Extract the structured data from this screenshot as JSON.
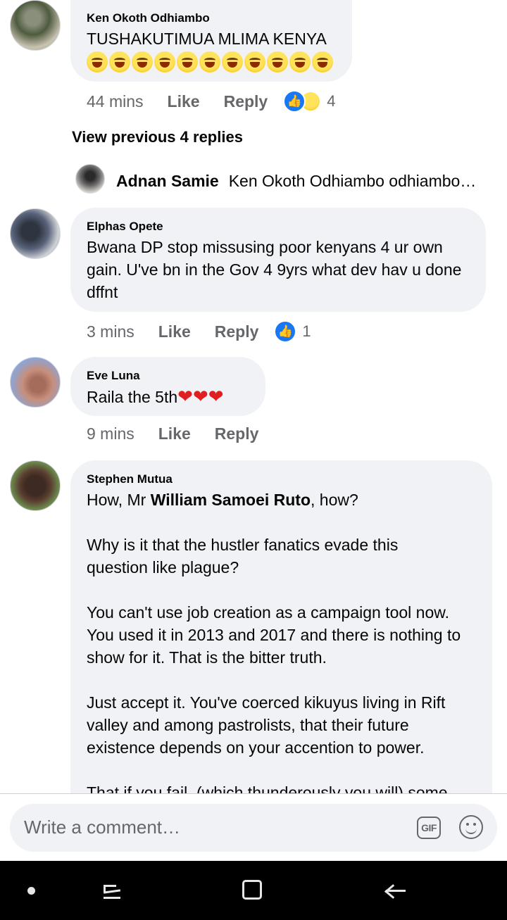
{
  "comments": [
    {
      "author": "Ken Okoth Odhiambo",
      "text": "TUSHAKUTIMUA MLIMA KENYA",
      "emoji_icon": "rolling-on-floor-laughing",
      "emoji_count": 11,
      "time": "44 mins",
      "like_label": "Like",
      "reply_label": "Reply",
      "reaction_icons": [
        "like",
        "haha"
      ],
      "reaction_count": "4"
    },
    {
      "author": "Elphas Opete",
      "text": "Bwana DP stop missusing poor kenyans 4 ur own\ngain. U've bn in the Gov 4 9yrs what dev hav u done\ndffnt",
      "time": "3 mins",
      "like_label": "Like",
      "reply_label": "Reply",
      "reaction_icons": [
        "like"
      ],
      "reaction_count": "1"
    },
    {
      "author": "Eve Luna",
      "text": "Raila the 5th",
      "emoji_icon": "red-heart",
      "emoji_count": 3,
      "time": "9 mins",
      "like_label": "Like",
      "reply_label": "Reply"
    },
    {
      "author": "Stephen Mutua",
      "text_prefix": "How, Mr ",
      "text_bold": "William Samoei Ruto",
      "text_suffix": ", how?",
      "paragraphs": [
        "Why is it that the hustler fanatics evade this\nquestion like plague?",
        "You can't use job creation as a campaign tool now.\nYou used it in 2013 and 2017 and there is nothing to\nshow for it. That is the bitter truth.",
        "Just accept it. You've coerced kikuyus living in Rift\nvalley and among pastrolists, that their future\nexistence depends on your accention to power.",
        "That if you fail, (which thunderously you will) some"
      ]
    }
  ],
  "replies": {
    "view_previous": "View previous 4 replies",
    "reply_author": "Adnan Samie",
    "reply_text": "Ken Okoth Odhiambo odhiambo…"
  },
  "composer": {
    "placeholder": "Write a comment…",
    "gif_label": "GIF",
    "emoji_icon": "smiley-icon"
  },
  "nav": {
    "icons": [
      "dot-icon",
      "recent-apps-icon",
      "home-icon",
      "back-icon"
    ]
  },
  "colors": {
    "bubble": "#f0f2f5",
    "accent": "#1877f2",
    "meta_text": "#65676b",
    "navbar": "#000000"
  }
}
